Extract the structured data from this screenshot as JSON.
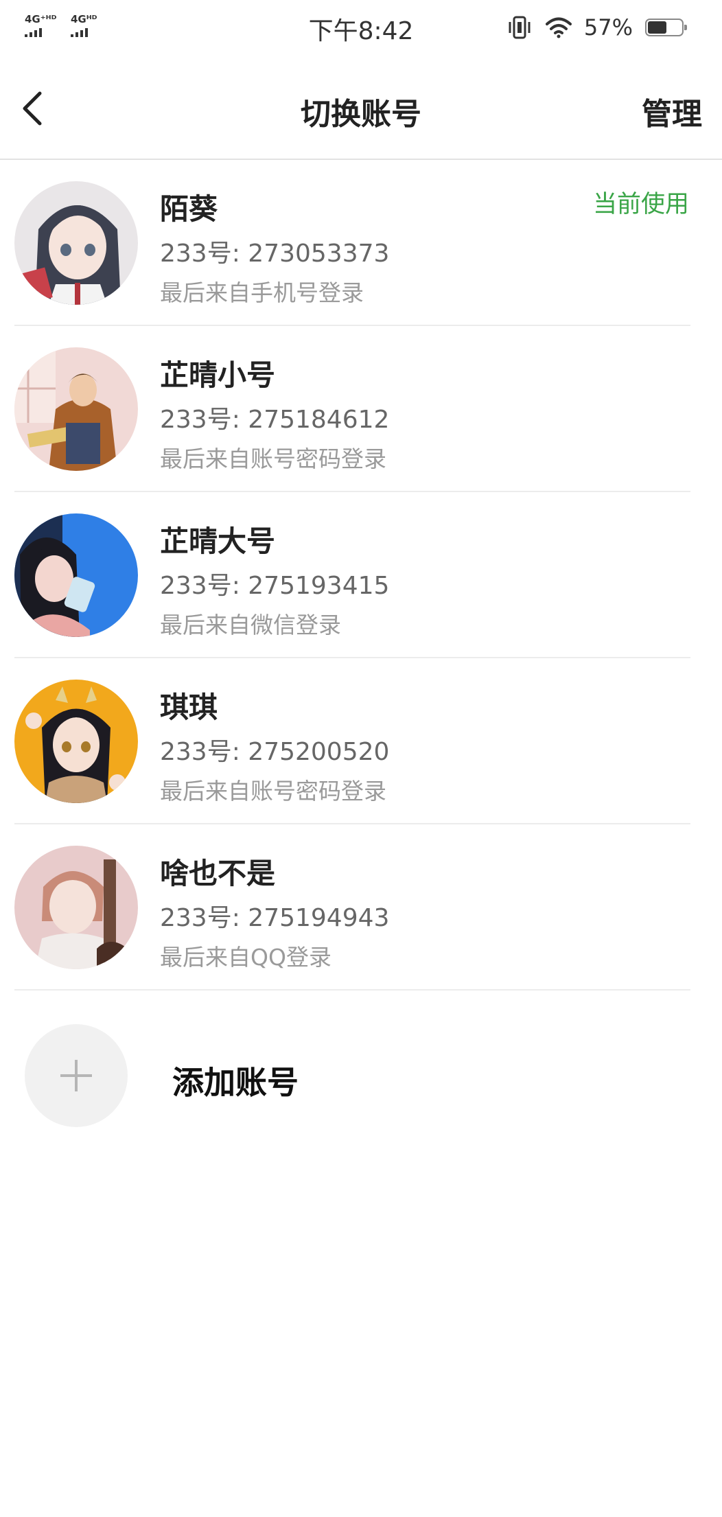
{
  "status_bar": {
    "network_1": "4G⁺ᴴᴰ",
    "network_2": "4Gᴴᴰ",
    "time": "下午8:42",
    "battery_percent": "57%",
    "battery_level": 0.57
  },
  "nav": {
    "title": "切换账号",
    "manage_label": "管理"
  },
  "accounts": [
    {
      "name": "陌葵",
      "id_text": "233号: 273053373",
      "login_text": "最后来自手机号登录",
      "badge": "当前使用"
    },
    {
      "name": "芷晴小号",
      "id_text": "233号: 275184612",
      "login_text": "最后来自账号密码登录"
    },
    {
      "name": "芷晴大号",
      "id_text": "233号: 275193415",
      "login_text": "最后来自微信登录"
    },
    {
      "name": "琪琪",
      "id_text": "233号: 275200520",
      "login_text": "最后来自账号密码登录"
    },
    {
      "name": "啥也不是",
      "id_text": "233号: 275194943",
      "login_text": "最后来自QQ登录"
    }
  ],
  "add_account": {
    "label": "添加账号"
  },
  "colors": {
    "accent_green": "#3aa547",
    "divider": "#ececec"
  },
  "icons": {
    "back": "chevron-left-icon",
    "vibrate": "vibrate-icon",
    "wifi": "wifi-icon",
    "battery": "battery-icon",
    "plus": "plus-icon"
  }
}
